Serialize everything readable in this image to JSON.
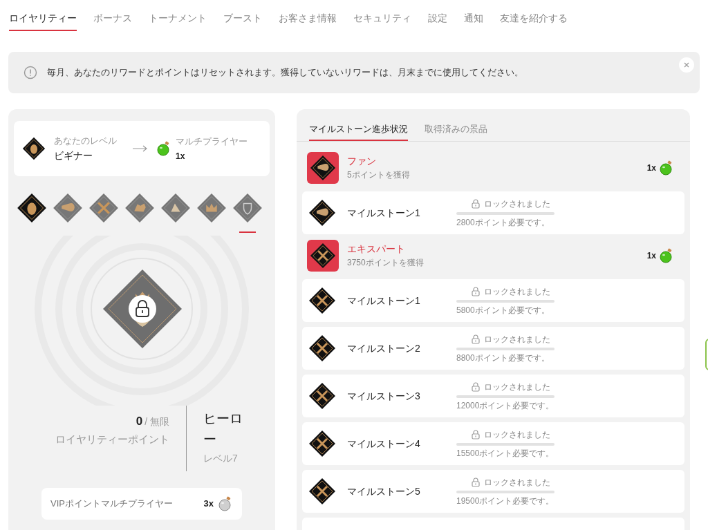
{
  "nav_tabs": [
    {
      "label": "ロイヤリティー",
      "selected": true
    },
    {
      "label": "ボーナス",
      "selected": false
    },
    {
      "label": "トーナメント",
      "selected": false
    },
    {
      "label": "ブースト",
      "selected": false
    },
    {
      "label": "お客さま情報",
      "selected": false
    },
    {
      "label": "セキュリティ",
      "selected": false
    },
    {
      "label": "設定",
      "selected": false
    },
    {
      "label": "通知",
      "selected": false
    },
    {
      "label": "友達を紹介する",
      "selected": false
    }
  ],
  "notice": {
    "text": "毎月、あなたのリワードとポイントはリセットされます。獲得していないリワードは、月末までに使用してください。"
  },
  "level_card": {
    "label": "あなたのレベル",
    "value": "ビギナー",
    "multiplier_label": "マルチプライヤー",
    "multiplier_value": "1x"
  },
  "level_badges": [
    {
      "unlocked": true,
      "selected": false
    },
    {
      "unlocked": false,
      "selected": false
    },
    {
      "unlocked": false,
      "selected": false
    },
    {
      "unlocked": false,
      "selected": false
    },
    {
      "unlocked": false,
      "selected": false
    },
    {
      "unlocked": false,
      "selected": false
    },
    {
      "unlocked": false,
      "selected": true
    }
  ],
  "current_badge": {
    "locked": true
  },
  "points": {
    "value": "0",
    "limit": "/ 無限",
    "label": "ロイヤリティーポイント"
  },
  "level_info": {
    "name": "ヒーロー",
    "level": "レベル7"
  },
  "vip_card": {
    "label": "VIPポイントマルチプライヤー",
    "value": "3x"
  },
  "panel_tabs": [
    {
      "label": "マイルストーン進歩状況",
      "selected": true
    },
    {
      "label": "取得済みの景品",
      "selected": false
    }
  ],
  "milestones": [
    {
      "kind": "tier",
      "title": "ファン",
      "subtitle": "5ポイントを獲得",
      "multiplier": "1x"
    },
    {
      "kind": "milestone",
      "name": "マイルストーン1",
      "status": "ロックされました",
      "level": 0,
      "requirement": "2800ポイント必要です。"
    },
    {
      "kind": "tier",
      "title": "エキスパート",
      "subtitle": "3750ポイントを獲得",
      "multiplier": "1x"
    },
    {
      "kind": "milestone",
      "name": "マイルストーン1",
      "status": "ロックされました",
      "level": 0,
      "requirement": "5800ポイント必要です。"
    },
    {
      "kind": "milestone",
      "name": "マイルストーン2",
      "status": "ロックされました",
      "level": 0,
      "requirement": "8800ポイント必要です。"
    },
    {
      "kind": "milestone",
      "name": "マイルストーン3",
      "status": "ロックされました",
      "level": 0,
      "requirement": "12000ポイント必要です。"
    },
    {
      "kind": "milestone",
      "name": "マイルストーン4",
      "status": "ロックされました",
      "level": 0,
      "requirement": "15500ポイント必要です。"
    },
    {
      "kind": "milestone",
      "name": "マイルストーン5",
      "status": "ロックされました",
      "level": 0,
      "requirement": "19500ポイント必要です。"
    },
    {
      "kind": "blank"
    }
  ]
}
